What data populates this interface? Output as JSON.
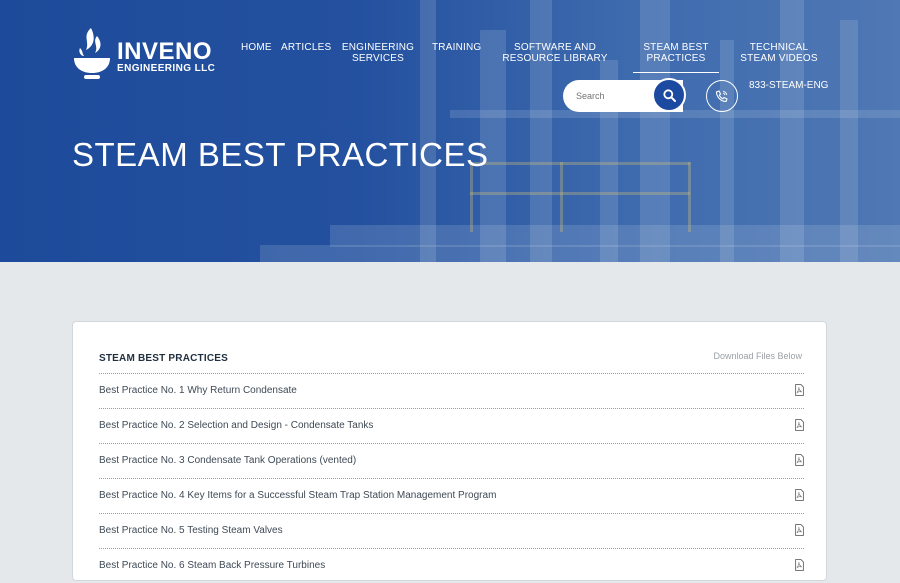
{
  "brand": {
    "name": "INVENO",
    "sub": "ENGINEERING LLC"
  },
  "nav": {
    "items": [
      {
        "label": "HOME"
      },
      {
        "label": "ARTICLES"
      },
      {
        "label": "ENGINEERING SERVICES"
      },
      {
        "label": "TRAINING"
      },
      {
        "label": "SOFTWARE AND RESOURCE LIBRARY"
      },
      {
        "label": "STEAM BEST PRACTICES"
      },
      {
        "label": "TECHNICAL STEAM VIDEOS"
      }
    ],
    "active": "STEAM BEST PRACTICES"
  },
  "search": {
    "placeholder": "Search",
    "icon": "search-icon"
  },
  "contact": {
    "phone": "833-STEAM-ENG",
    "icon": "phone-icon"
  },
  "hero": {
    "title": "STEAM BEST PRACTICES"
  },
  "card": {
    "title": "STEAM BEST PRACTICES",
    "note": "Download Files Below",
    "items": [
      {
        "label": "Best Practice No. 1 Why Return Condensate"
      },
      {
        "label": "Best Practice No. 2 Selection and Design - Condensate Tanks"
      },
      {
        "label": "Best Practice No. 3 Condensate Tank Operations (vented)"
      },
      {
        "label": "Best Practice No. 4 Key Items for a Successful Steam Trap Station Management Program"
      },
      {
        "label": "Best Practice No. 5 Testing Steam Valves"
      },
      {
        "label": "Best Practice No. 6 Steam Back Pressure Turbines"
      }
    ],
    "item_icon": "pdf-file-icon"
  },
  "colors": {
    "hero_blue": "#1d4a9a",
    "button_blue": "#1c4aa0",
    "page_bg": "#e4e8eb",
    "divider": "#7fa3cf"
  }
}
